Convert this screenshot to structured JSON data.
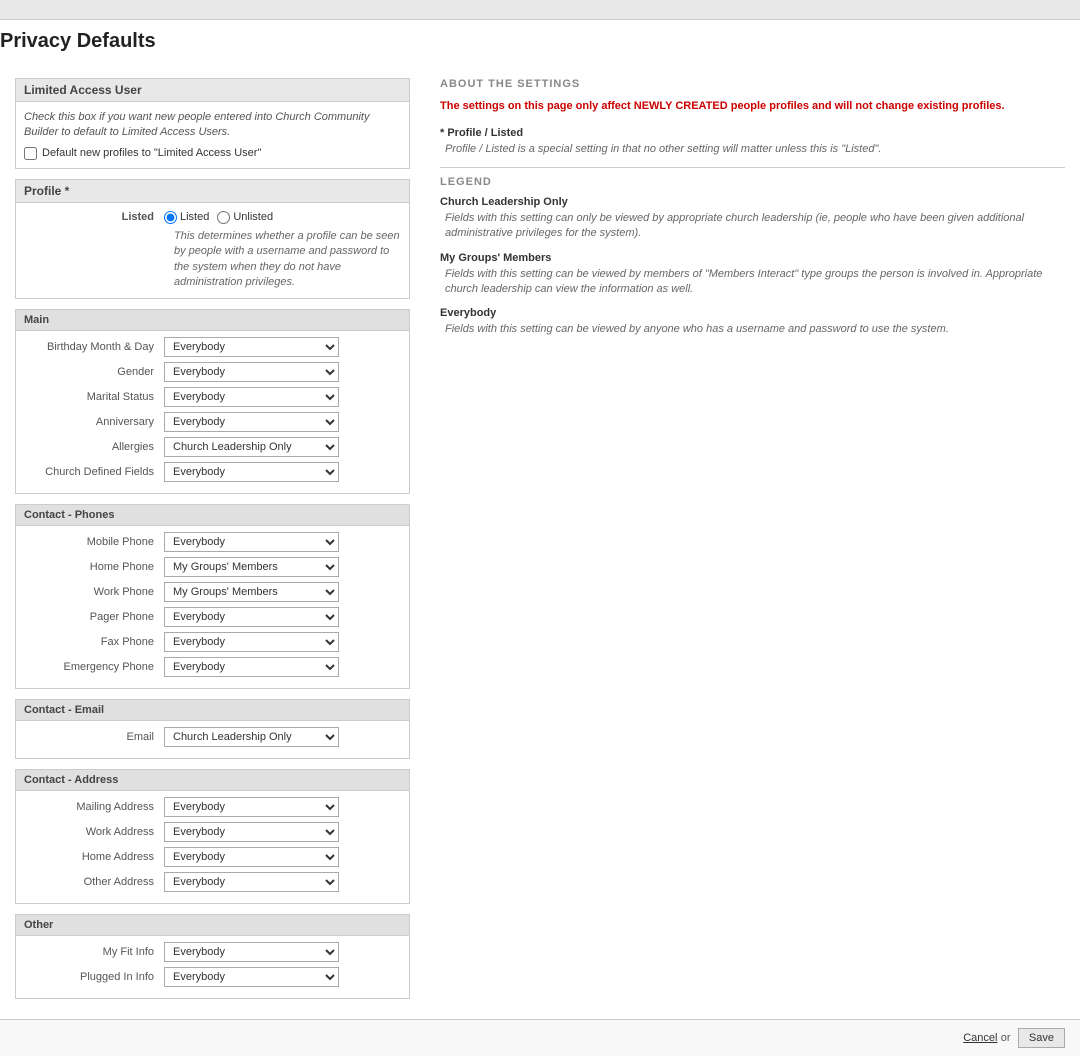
{
  "page": {
    "title": "Privacy Defaults",
    "top_bar": ""
  },
  "limited_access": {
    "section_title": "Limited Access User",
    "description": "Check this box if you want new people entered into Church Community Builder to default to Limited Access Users.",
    "checkbox_label": "Default new profiles to \"Limited Access User\""
  },
  "profile": {
    "section_title": "Profile",
    "section_asterisk": true,
    "listed_label": "Listed",
    "radio_listed": "Listed",
    "radio_unlisted": "Unlisted",
    "note": "This determines whether a profile can be seen by people with a username and password to the system when they do not have administration privileges."
  },
  "main": {
    "section_title": "Main",
    "fields": [
      {
        "label": "Birthday Month & Day",
        "value": "Everybody"
      },
      {
        "label": "Gender",
        "value": "Everybody"
      },
      {
        "label": "Marital Status",
        "value": "Everybody"
      },
      {
        "label": "Anniversary",
        "value": "Everybody"
      },
      {
        "label": "Allergies",
        "value": "Church Leadership Only"
      },
      {
        "label": "Church Defined Fields",
        "value": "Everybody"
      }
    ]
  },
  "contact_phones": {
    "section_title": "Contact - Phones",
    "fields": [
      {
        "label": "Mobile Phone",
        "value": "Everybody"
      },
      {
        "label": "Home Phone",
        "value": "My Groups' Members"
      },
      {
        "label": "Work Phone",
        "value": "My Groups' Members"
      },
      {
        "label": "Pager Phone",
        "value": "Everybody"
      },
      {
        "label": "Fax Phone",
        "value": "Everybody"
      },
      {
        "label": "Emergency Phone",
        "value": "Everybody"
      }
    ]
  },
  "contact_email": {
    "section_title": "Contact - Email",
    "fields": [
      {
        "label": "Email",
        "value": "Church Leadership Only"
      }
    ]
  },
  "contact_address": {
    "section_title": "Contact - Address",
    "fields": [
      {
        "label": "Mailing Address",
        "value": "Everybody"
      },
      {
        "label": "Work Address",
        "value": "Everybody"
      },
      {
        "label": "Home Address",
        "value": "Everybody"
      },
      {
        "label": "Other Address",
        "value": "Everybody"
      }
    ]
  },
  "other": {
    "section_title": "Other",
    "fields": [
      {
        "label": "My Fit Info",
        "value": "Everybody"
      },
      {
        "label": "Plugged In Info",
        "value": "Everybody"
      }
    ]
  },
  "right_panel": {
    "about_header": "ABOUT THE SETTINGS",
    "alert_text": "The settings on this page only affect NEWLY CREATED people profiles and will not change existing profiles.",
    "profile_listed_label": "* Profile / Listed",
    "profile_listed_note": "Profile / Listed is a special setting in that no other setting will matter unless this is \"Listed\".",
    "legend_header": "LEGEND",
    "legend_items": [
      {
        "title": "Church Leadership Only",
        "desc": "Fields with this setting can only be viewed by appropriate church leadership (ie, people who have been given additional administrative privileges for the system)."
      },
      {
        "title": "My Groups' Members",
        "desc": "Fields with this setting can be viewed by members of \"Members Interact\" type groups the person is involved in. Appropriate church leadership can view the information as well."
      },
      {
        "title": "Everybody",
        "desc": "Fields with this setting can be viewed by anyone who has a username and password to use the system."
      }
    ]
  },
  "footer": {
    "cancel_label": "Cancel",
    "or_label": "or",
    "save_label": "Save"
  },
  "select_options": [
    "Everybody",
    "My Groups' Members",
    "Church Leadership Only"
  ]
}
